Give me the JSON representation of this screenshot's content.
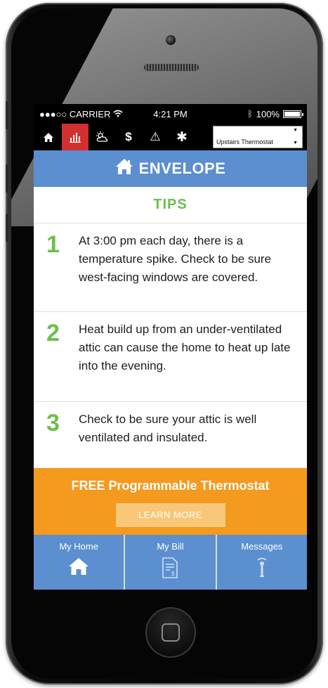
{
  "status": {
    "carrier": "●●●○○ CARRIER",
    "time": "4:21 PM",
    "battery": "100%"
  },
  "toolbar": {
    "icons": [
      "home-icon",
      "bar-chart-icon",
      "weather-icon",
      "dollar-icon",
      "warning-icon",
      "gear-icon"
    ],
    "dollar": "$",
    "warning": "⚠",
    "gear": "✱",
    "thermostat_select": "Upstairs Thermostat"
  },
  "header": {
    "title": "ENVELOPE"
  },
  "tips": {
    "heading": "TIPS",
    "items": [
      {
        "number": "1",
        "text": "At 3:00 pm each day, there is a temperature spike. Check to be sure west-facing windows are covered."
      },
      {
        "number": "2",
        "text": "Heat build up from an under-ventilated attic can cause the home to heat up late into the evening."
      },
      {
        "number": "3",
        "text": "Check to be sure your attic is well ventilated and insulated."
      }
    ]
  },
  "promo": {
    "title": "FREE Programmable Thermostat",
    "button": "LEARN MORE"
  },
  "bottom_nav": {
    "items": [
      {
        "label": "My Home",
        "icon": "house-icon"
      },
      {
        "label": "My Bill",
        "icon": "bill-icon"
      },
      {
        "label": "Messages",
        "icon": "messages-icon"
      }
    ]
  },
  "colors": {
    "header_blue": "#5b8fd0",
    "tip_green": "#6cbf4d",
    "promo_orange": "#f39a1f",
    "active_red": "#d22f2f"
  }
}
